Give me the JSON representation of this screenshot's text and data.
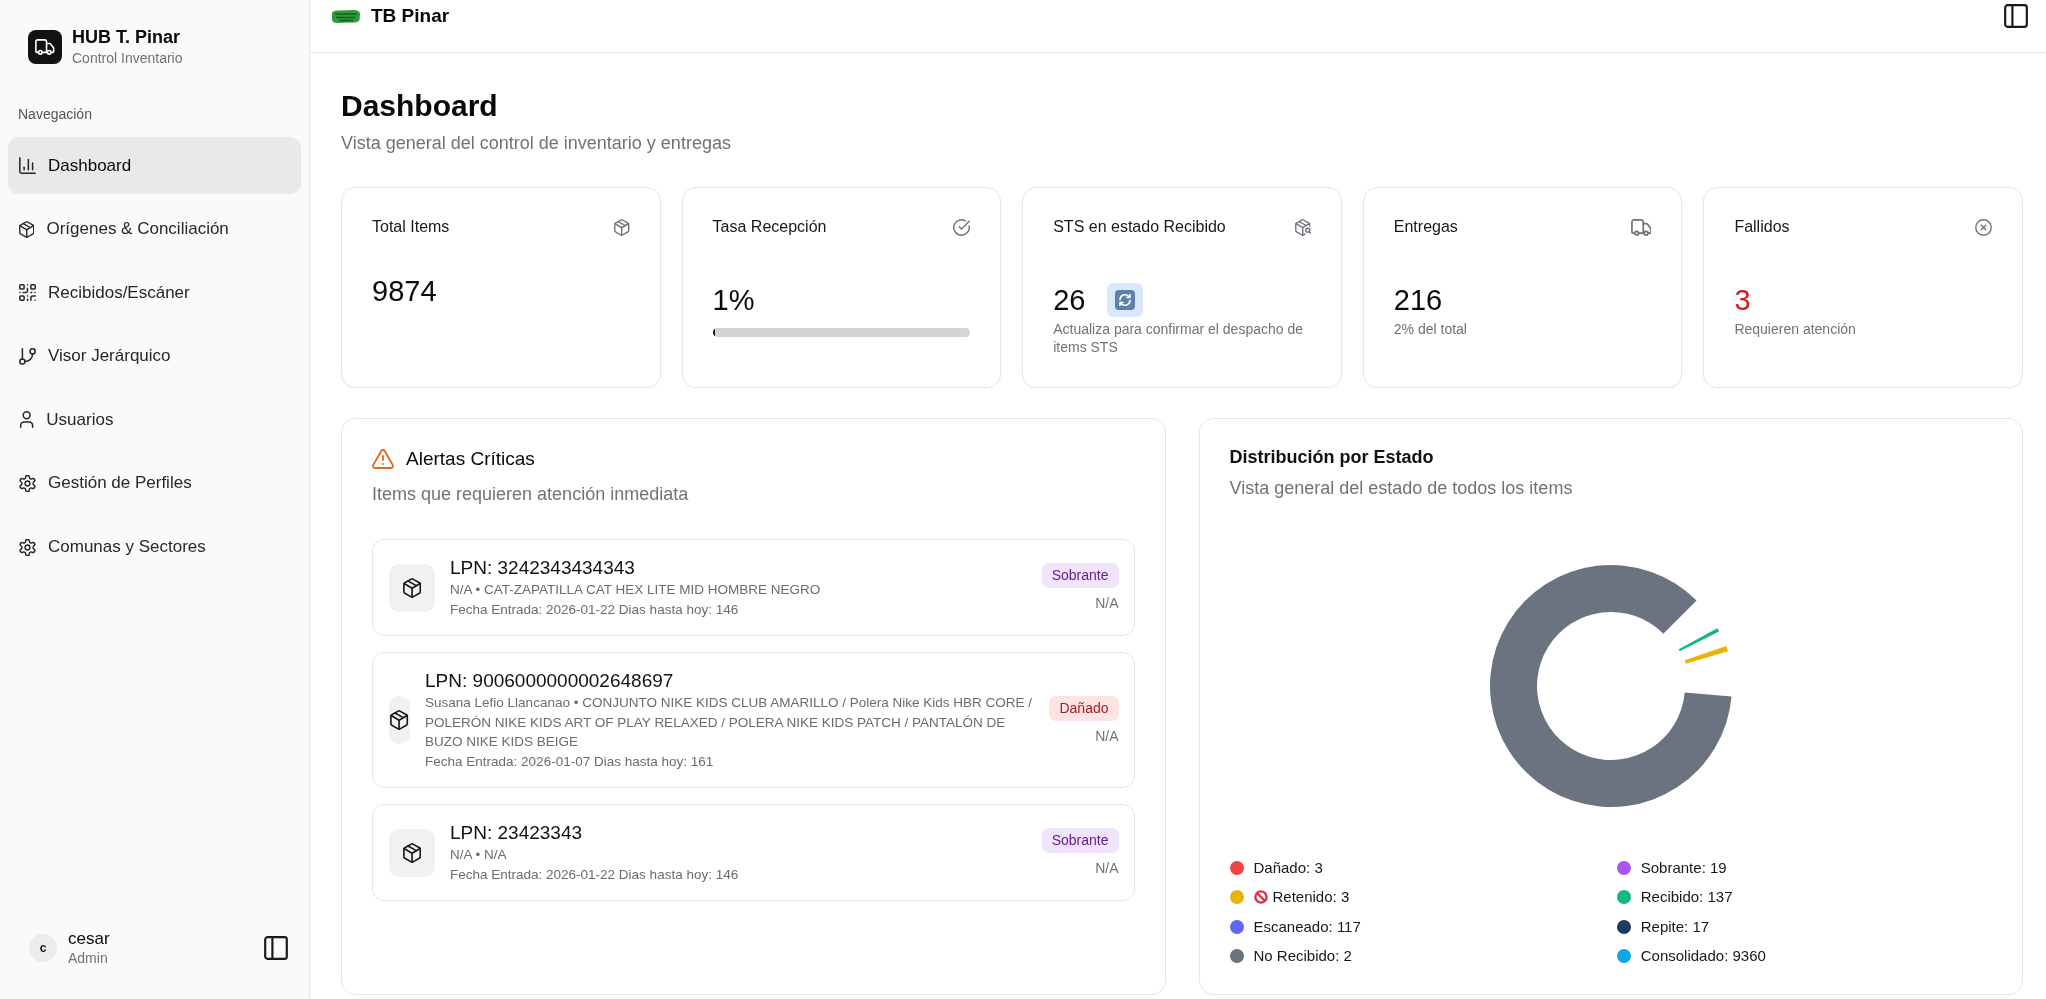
{
  "sidebar": {
    "brand": {
      "title": "HUB T. Pinar",
      "subtitle": "Control Inventario"
    },
    "section_label": "Navegación",
    "items": [
      {
        "label": "Dashboard",
        "selected": true
      },
      {
        "label": "Orígenes & Conciliación",
        "selected": false
      },
      {
        "label": "Recibidos/Escáner",
        "selected": false
      },
      {
        "label": "Visor Jerárquico",
        "selected": false
      },
      {
        "label": "Usuarios",
        "selected": false
      },
      {
        "label": "Gestión de Perfiles",
        "selected": false
      },
      {
        "label": "Comunas y Sectores",
        "selected": false
      }
    ],
    "user": {
      "initial": "c",
      "name": "cesar",
      "role": "Admin"
    }
  },
  "header": {
    "title": "TB Pinar"
  },
  "page": {
    "title": "Dashboard",
    "subtitle": "Vista general del control de inventario y entregas"
  },
  "stats": [
    {
      "kind": "count",
      "title": "Total Items",
      "value": "9874"
    },
    {
      "kind": "progress",
      "title": "Tasa Recepción",
      "value": "1%",
      "level": 0.01
    },
    {
      "kind": "refresh",
      "title": "STS en estado Recibido",
      "value": "26",
      "note": "Actualiza para confirmar el despacho de items STS"
    },
    {
      "kind": "count",
      "title": "Entregas",
      "value": "216",
      "note": "2% del total"
    },
    {
      "kind": "alert",
      "title": "Fallidos",
      "value": "3",
      "note": "Requieren atención"
    }
  ],
  "alerts": {
    "title": "Alertas Críticas",
    "subtitle": "Items que requieren atención inmediata",
    "items": [
      {
        "lpn": "LPN: 3242343434343",
        "description": "N/A • CAT-ZAPATILLA CAT HEX LITE MID HOMBRE NEGRO",
        "entry": "Fecha Entrada: 2026-01-22 Dias hasta hoy: 146",
        "status": "Sobrante",
        "kind": "surplus",
        "value": "N/A"
      },
      {
        "lpn": "LPN: 9006000000002648697",
        "description": "Susana Lefio Llancanao • CONJUNTO NIKE KIDS CLUB AMARILLO / Polera Nike Kids HBR CORE / POLERÓN NIKE KIDS ART OF PLAY RELAXED / POLERA NIKE KIDS PATCH / PANTALÓN DE BUZO NIKE KIDS BEIGE",
        "entry": "Fecha Entrada: 2026-01-07 Dias hasta hoy: 161",
        "status": "Dañado",
        "kind": "damaged",
        "value": "N/A"
      },
      {
        "lpn": "LPN: 23423343",
        "description": "N/A • N/A",
        "entry": "Fecha Entrada: 2026-01-22 Dias hasta hoy: 146",
        "status": "Sobrante",
        "kind": "surplus",
        "value": "N/A"
      }
    ]
  },
  "distribution": {
    "title": "Distribución por Estado",
    "subtitle": "Vista general del estado de todos los items",
    "legend": [
      {
        "label": "Dañado: 3",
        "color": "#ef4444",
        "kind": "plain"
      },
      {
        "label": "Sobrante: 19",
        "color": "#a855f7",
        "kind": "plain"
      },
      {
        "label": "Retenido: 3",
        "color": "#eab308",
        "kind": "blocked"
      },
      {
        "label": "Recibido: 137",
        "color": "#10b981",
        "kind": "plain"
      },
      {
        "label": "Escaneado: 117",
        "color": "#6366f1",
        "kind": "plain"
      },
      {
        "label": "Repite: 17",
        "color": "#1e3a5f",
        "kind": "plain"
      },
      {
        "label": "No Recibido: 2",
        "color": "#6b7280",
        "kind": "plain"
      },
      {
        "label": "Consolidado: 9360",
        "color": "#0ea5e9",
        "kind": "plain"
      }
    ]
  }
}
